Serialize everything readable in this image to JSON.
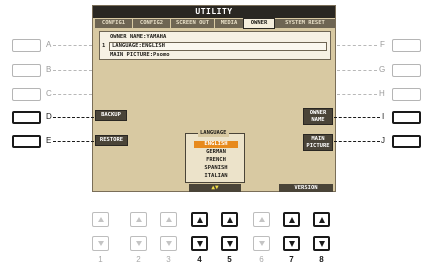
{
  "screen": {
    "title": "UTILITY",
    "tabs": [
      {
        "label": "CONFIG1",
        "active": false
      },
      {
        "label": "CONFIG2",
        "active": false
      },
      {
        "label": "SCREEN OUT",
        "active": false
      },
      {
        "label": "MEDIA",
        "active": false
      },
      {
        "label": "OWNER",
        "active": true
      },
      {
        "label": "SYSTEM RESET",
        "active": false
      }
    ],
    "row_number": "1",
    "owner_name": "OWNER NAME:YAMAHA",
    "language_row": "LANGUAGE:ENGLISH",
    "main_picture": "MAIN PICTURE:Psomo",
    "soft_buttons": {
      "backup": "BACKUP",
      "restore": "RESTORE",
      "owner_name": "OWNER NAME",
      "main_picture": "MAIN PICTURE"
    },
    "language_list": {
      "title": "LANGUAGE",
      "items": [
        "ENGLISH",
        "GERMAN",
        "FRENCH",
        "SPANISH",
        "ITALIAN"
      ],
      "selected": "ENGLISH"
    },
    "arrow_button": "▲▼",
    "version_button": "VERSION"
  },
  "side_buttons": {
    "left": [
      {
        "letter": "A",
        "active": false
      },
      {
        "letter": "B",
        "active": false
      },
      {
        "letter": "C",
        "active": false
      },
      {
        "letter": "D",
        "active": true
      },
      {
        "letter": "E",
        "active": true
      }
    ],
    "right": [
      {
        "letter": "F",
        "active": false
      },
      {
        "letter": "G",
        "active": false
      },
      {
        "letter": "H",
        "active": false
      },
      {
        "letter": "I",
        "active": true
      },
      {
        "letter": "J",
        "active": true
      }
    ]
  },
  "bottom_buttons": [
    {
      "number": "1",
      "active": false
    },
    {
      "number": "2",
      "active": false
    },
    {
      "number": "3",
      "active": false
    },
    {
      "number": "4",
      "active": true
    },
    {
      "number": "5",
      "active": true
    },
    {
      "number": "6",
      "active": false
    },
    {
      "number": "7",
      "active": true
    },
    {
      "number": "8",
      "active": true
    }
  ],
  "icons": {
    "up": "up-triangle-icon",
    "down": "down-triangle-icon"
  },
  "colors": {
    "lcd_background": "#d8c9a2",
    "title_bar": "#2a2722",
    "selection": "#e78a1d",
    "button_fill": "#4a4438"
  }
}
